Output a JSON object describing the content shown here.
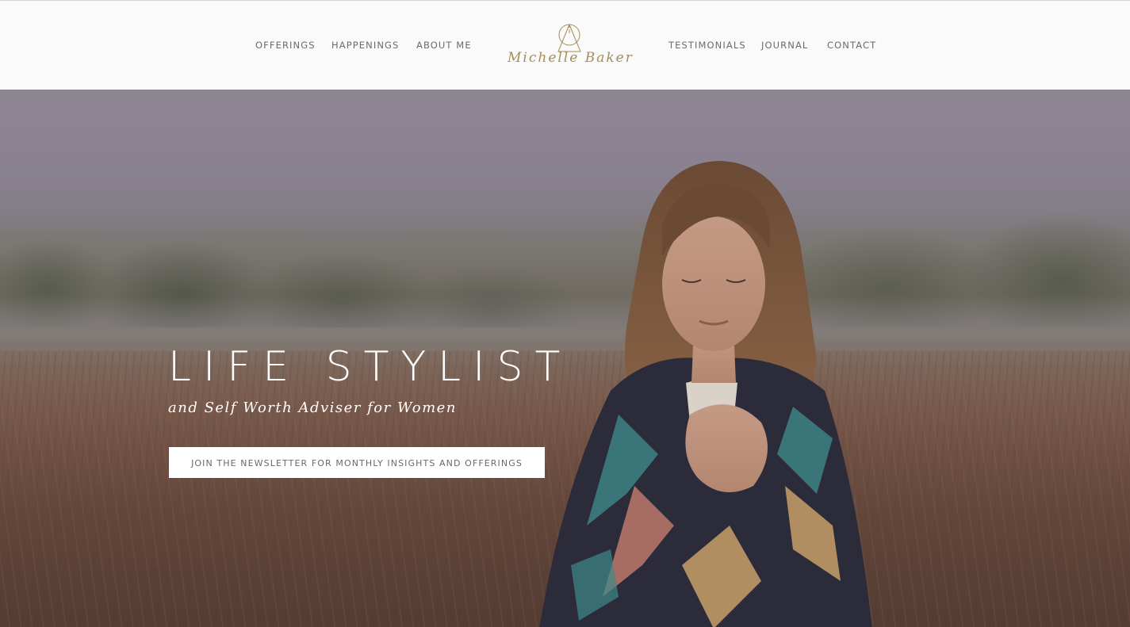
{
  "nav": {
    "left": [
      {
        "label": "OFFERINGS"
      },
      {
        "label": "HAPPENINGS"
      },
      {
        "label": "ABOUT ME"
      }
    ],
    "right": [
      {
        "label": "TESTIMONIALS"
      },
      {
        "label": "JOURNAL"
      },
      {
        "label": "CONTACT"
      }
    ]
  },
  "logo": {
    "text": "Michelle Baker",
    "icon": "triangle-circle-mark-icon",
    "color": "#a78c57"
  },
  "hero": {
    "heading": "LIFE STYLIST",
    "subheading": "and Self Worth Adviser for Women",
    "button_label": "JOIN THE NEWSLETTER FOR MONTHLY INSIGHTS AND OFFERINGS",
    "image_description_icon": "woman-in-field-photo"
  },
  "colors": {
    "header_bg": "#fafafa",
    "nav_text": "#6b6b6b",
    "hero_text": "#ffffff",
    "button_bg": "#ffffff",
    "button_text": "#6a6a6a"
  }
}
